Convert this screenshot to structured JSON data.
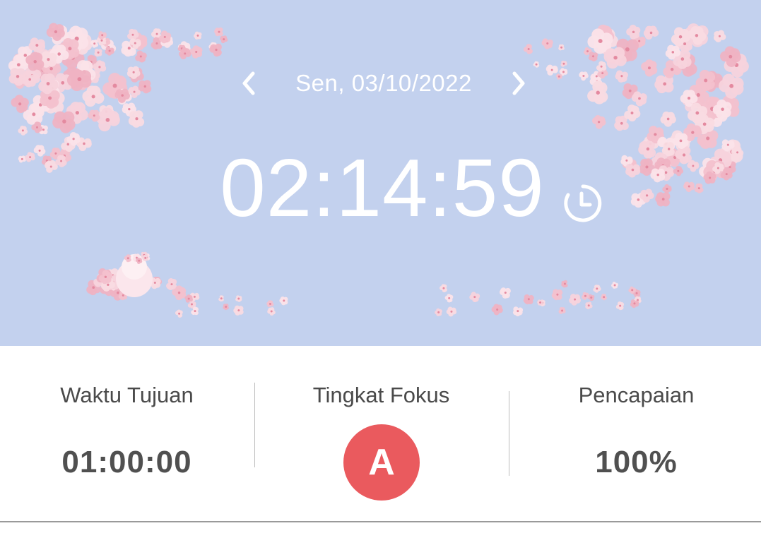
{
  "header": {
    "date": "Sen, 03/10/2022",
    "prev_icon": "chevron-left-icon",
    "next_icon": "chevron-right-icon"
  },
  "timer": {
    "elapsed": "02:14:59",
    "icon": "clock-icon"
  },
  "stats": {
    "target_time": {
      "label": "Waktu Tujuan",
      "value": "01:00:00"
    },
    "focus_level": {
      "label": "Tingkat Fokus",
      "value": "A"
    },
    "achievement": {
      "label": "Pencapaian",
      "value": "100%"
    }
  },
  "colors": {
    "background": "#c3d1ee",
    "grade_badge": "#ea5a5e",
    "blossom": "#f4c9d3"
  }
}
